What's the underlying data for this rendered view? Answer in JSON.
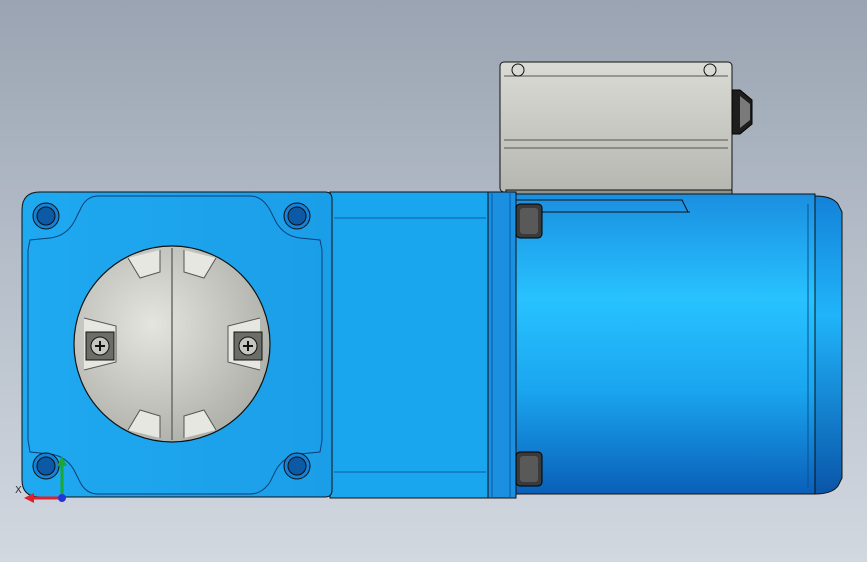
{
  "viewport": {
    "background_top": "#9aa4b2",
    "background_bottom": "#d2d8e0"
  },
  "model": {
    "body_color": "#1fa3ec",
    "body_color_light": "#27c0ff",
    "body_color_dark": "#0c6fc4",
    "flange_color": "#1aa6ee",
    "terminal_box_color": "#c6c8c2",
    "shaft_cover_color": "#c9cac4",
    "outline_color": "#111111"
  },
  "axis_triad": {
    "x_label": "X",
    "x_color": "#e0202a",
    "y_color": "#1aa832",
    "z_color": "#2436d8"
  }
}
